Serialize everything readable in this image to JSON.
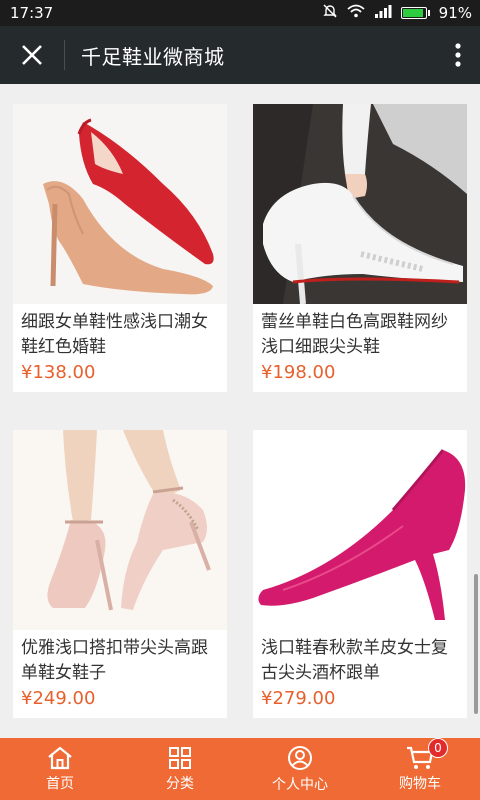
{
  "status_bar": {
    "time": "17:37",
    "battery": "91%"
  },
  "header": {
    "title": "千足鞋业微商城"
  },
  "products": [
    {
      "name": "细跟女单鞋性感浅口潮女鞋红色婚鞋",
      "price": "¥138.00",
      "image": "red and nude pointed heels"
    },
    {
      "name": "蕾丝单鞋白色高跟鞋网纱浅口细跟尖头鞋",
      "price": "¥198.00",
      "image": "white lace high heel"
    },
    {
      "name": "优雅浅口搭扣带尖头高跟单鞋女鞋子",
      "price": "¥249.00",
      "image": "pink ankle strap heels"
    },
    {
      "name": "浅口鞋春秋款羊皮女士复古尖头酒杯跟单",
      "price": "¥279.00",
      "image": "magenta suede pump"
    }
  ],
  "tabbar": {
    "items": [
      {
        "label": "首页",
        "icon": "home-icon"
      },
      {
        "label": "分类",
        "icon": "grid-icon"
      },
      {
        "label": "个人中心",
        "icon": "user-icon"
      },
      {
        "label": "购物车",
        "icon": "cart-icon"
      }
    ],
    "cart_badge": "0"
  },
  "colors": {
    "accent": "#ef6a34",
    "price": "#e8602c",
    "header_bg": "#252a2d"
  }
}
